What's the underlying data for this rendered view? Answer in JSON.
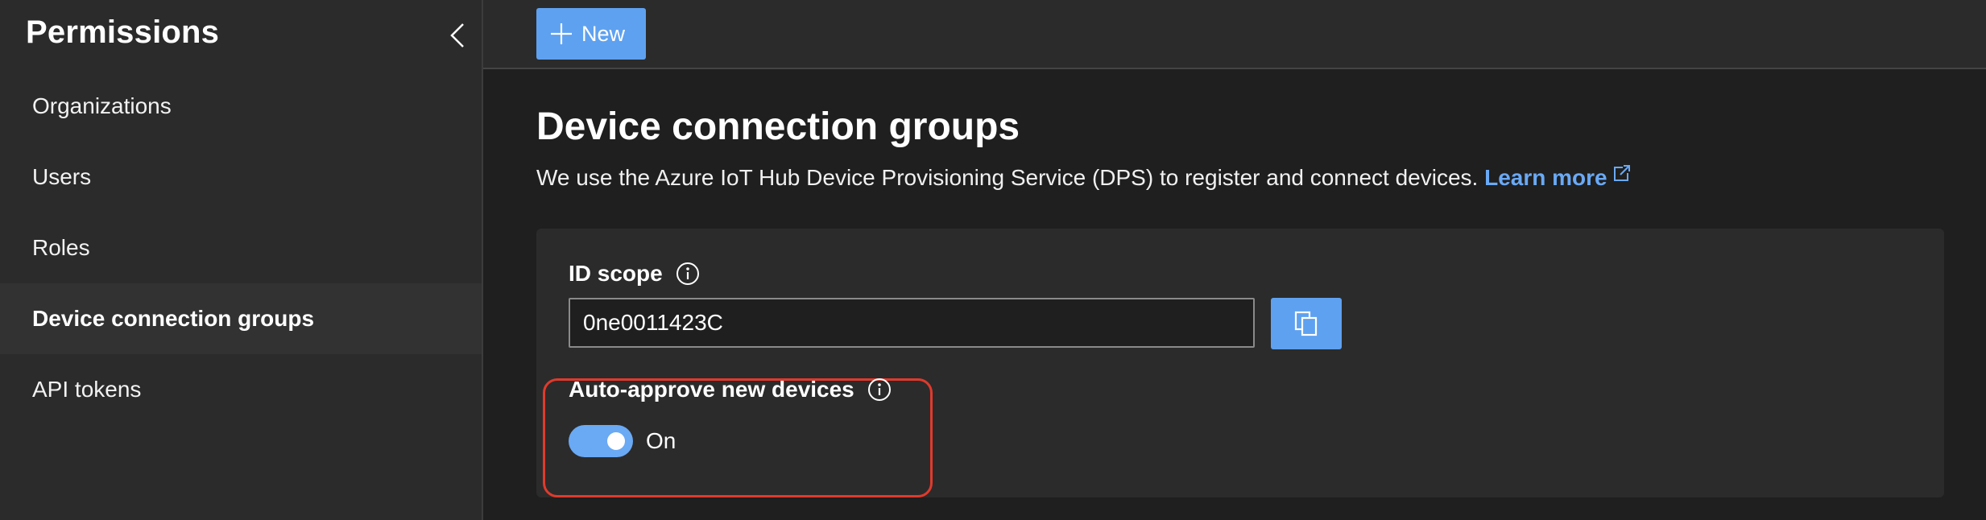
{
  "sidebar": {
    "title": "Permissions",
    "collapse_icon": "chevron-left-icon",
    "items": [
      {
        "label": "Organizations"
      },
      {
        "label": "Users"
      },
      {
        "label": "Roles"
      },
      {
        "label": "Device connection groups",
        "active": true
      },
      {
        "label": "API tokens"
      }
    ]
  },
  "toolbar": {
    "new_label": "New",
    "new_icon": "plus-icon"
  },
  "main": {
    "title": "Device connection groups",
    "description": "We use the Azure IoT Hub Device Provisioning Service (DPS) to register and connect devices.",
    "learn_more": "Learn more",
    "learn_more_icon": "external-link-icon",
    "id_scope": {
      "label": "ID scope",
      "value": "0ne0011423C",
      "info_icon": "info-icon",
      "copy_icon": "copy-icon"
    },
    "auto_approve": {
      "label": "Auto-approve new devices",
      "state": "On",
      "enabled": true,
      "info_icon": "info-icon"
    }
  },
  "colors": {
    "accent": "#5ea1f0",
    "link": "#6aa9f4",
    "highlight": "#e03a2c",
    "sidebar_bg": "#2b2b2b",
    "main_bg": "#1f1f1f"
  }
}
